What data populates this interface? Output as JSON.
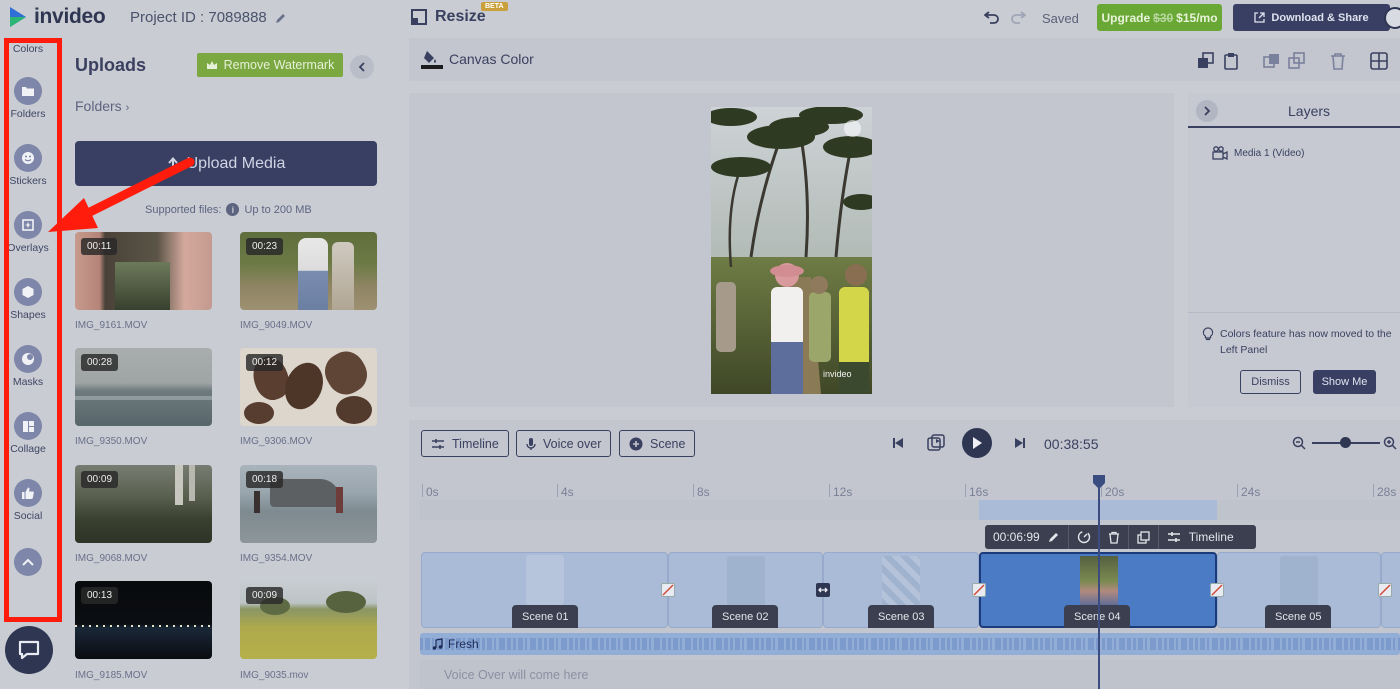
{
  "header": {
    "logo_text": "invideo",
    "project_id": "Project ID : 7089888",
    "resize_label": "Resize",
    "beta_badge": "BETA",
    "saved_status": "Saved",
    "upgrade_old_price": "$30",
    "upgrade_label": "Upgrade",
    "upgrade_new_price": "$15/mo",
    "download_label": "Download & Share"
  },
  "rail": {
    "items": [
      {
        "label": "Colors",
        "icon": "colors-icon"
      },
      {
        "label": "Folders",
        "icon": "folder-icon"
      },
      {
        "label": "Stickers",
        "icon": "smiley-icon"
      },
      {
        "label": "Overlays",
        "icon": "overlay-icon"
      },
      {
        "label": "Shapes",
        "icon": "hexagon-icon"
      },
      {
        "label": "Masks",
        "icon": "mask-icon"
      },
      {
        "label": "Collage",
        "icon": "collage-icon"
      },
      {
        "label": "Social",
        "icon": "thumbs-up-icon"
      }
    ]
  },
  "uploads": {
    "title": "Uploads",
    "remove_watermark": "Remove Watermark",
    "folders_link": "Folders",
    "upload_media": "Upload Media",
    "supported_files": "Supported files:",
    "info_glyph": "i",
    "max_size": "Up to 200 MB",
    "files": [
      {
        "duration": "00:11",
        "name": "IMG_9161.MOV"
      },
      {
        "duration": "00:23",
        "name": "IMG_9049.MOV"
      },
      {
        "duration": "00:28",
        "name": "IMG_9350.MOV"
      },
      {
        "duration": "00:12",
        "name": "IMG_9306.MOV"
      },
      {
        "duration": "00:09",
        "name": "IMG_9068.MOV"
      },
      {
        "duration": "00:18",
        "name": "IMG_9354.MOV"
      },
      {
        "duration": "00:13",
        "name": "IMG_9185.MOV"
      },
      {
        "duration": "00:09",
        "name": "IMG_9035.mov"
      }
    ]
  },
  "canvas": {
    "canvas_color_label": "Canvas Color",
    "watermark_text": "invideo"
  },
  "layers": {
    "title": "Layers",
    "item": "Media 1 (Video)",
    "note": "Colors feature has now moved to the Left Panel",
    "dismiss": "Dismiss",
    "show_me": "Show Me"
  },
  "timeline": {
    "timeline_btn": "Timeline",
    "voice_over_btn": "Voice over",
    "scene_btn": "Scene",
    "current_time": "00:38:55",
    "ruler": [
      "0s",
      "4s",
      "8s",
      "12s",
      "16s",
      "20s",
      "24s",
      "28s"
    ],
    "scene_toolbar_duration": "00:06:99",
    "scene_toolbar_timeline": "Timeline",
    "scenes": [
      "Scene 01",
      "Scene 02",
      "Scene 03",
      "Scene 04",
      "Scene 05"
    ],
    "audio_track": "Fresh",
    "voice_placeholder": "Voice Over will come here"
  },
  "colors": {
    "navy": "#383f63",
    "green": "#6aa836",
    "selected_scene": "#4a7bc4",
    "annotation_red": "#ff1c0c"
  }
}
